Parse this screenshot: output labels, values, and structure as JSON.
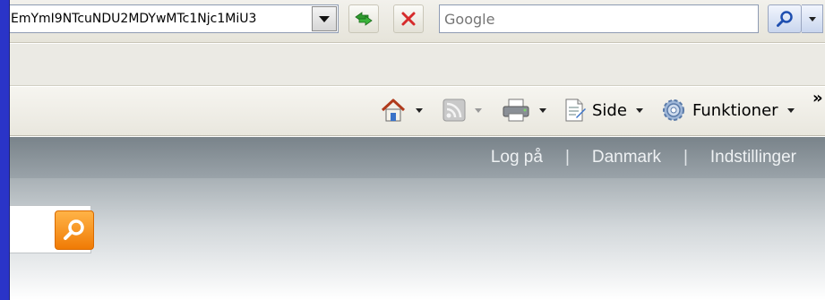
{
  "address_bar": {
    "url": "EmYmI9NTcuNDU2MDYwMTc1Njc1MiU3"
  },
  "search": {
    "placeholder": "Google"
  },
  "command_bar": {
    "page_label": "Side",
    "tools_label": "Funktioner",
    "overflow": "»"
  },
  "site_header": {
    "links": [
      "Log på",
      "Danmark",
      "Indstillinger"
    ],
    "separator": "|"
  },
  "colors": {
    "accent_blue": "#2a34c8",
    "search_orange": "#f07b05"
  },
  "icons": [
    "refresh-icon",
    "stop-icon",
    "search-icon",
    "home-icon",
    "rss-feed-icon",
    "print-icon",
    "page-icon",
    "tools-gear-icon"
  ]
}
